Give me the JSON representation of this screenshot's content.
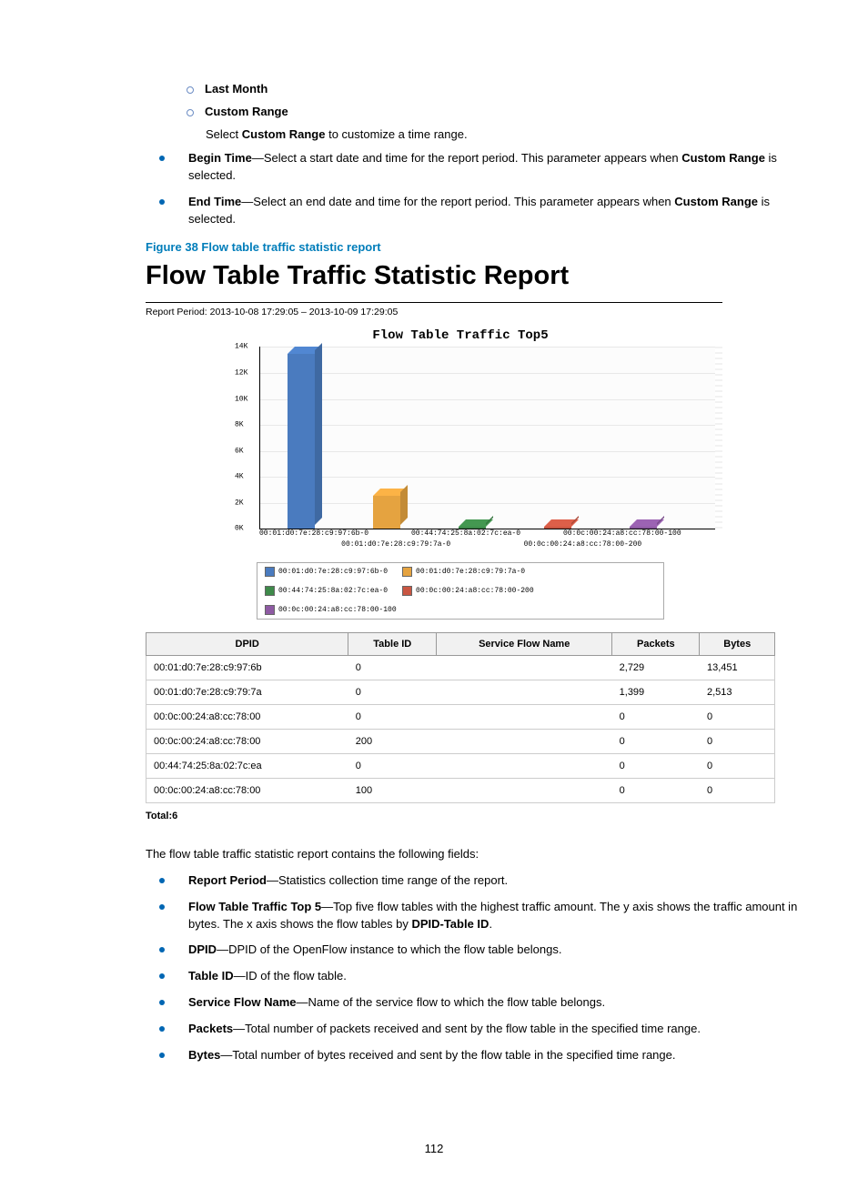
{
  "sub_items": [
    {
      "label": "Last Month"
    },
    {
      "label": "Custom Range"
    }
  ],
  "select_hint": {
    "pre": "Select ",
    "bold": "Custom Range",
    "post": " to customize a time range."
  },
  "upper_bullets": [
    {
      "bold": "Begin Time",
      "tail": "—Select a start date and time for the report period. This parameter appears when ",
      "bold2": "Custom Range",
      "tail2": " is selected."
    },
    {
      "bold": "End Time",
      "tail": "—Select an end date and time for the report period. This parameter appears when ",
      "bold2": "Custom Range",
      "tail2": " is selected."
    }
  ],
  "figure_caption": "Figure 38 Flow table traffic statistic report",
  "report_title": "Flow Table Traffic Statistic Report",
  "report_period": "Report Period: 2013-10-08 17:29:05  –  2013-10-09 17:29:05",
  "chart_data": {
    "type": "bar",
    "title": "Flow Table Traffic Top5",
    "y_ticks": [
      "0K",
      "2K",
      "4K",
      "6K",
      "8K",
      "10K",
      "12K",
      "14K"
    ],
    "ylim": [
      0,
      14000
    ],
    "x_top": [
      "00:01:d0:7e:28:c9:97:6b-0",
      "00:44:74:25:8a:02:7c:ea-0",
      "00:0c:00:24:a8:cc:78:00-100"
    ],
    "x_bot": [
      "00:01:d0:7e:28:c9:79:7a-0",
      "00:0c:00:24:a8:cc:78:00-200"
    ],
    "series": [
      {
        "name": "00:01:d0:7e:28:c9:97:6b-0",
        "value": 13451,
        "color": "#4a7bbf"
      },
      {
        "name": "00:01:d0:7e:28:c9:79:7a-0",
        "value": 2513,
        "color": "#e5a340"
      },
      {
        "name": "00:44:74:25:8a:02:7c:ea-0",
        "value": 120,
        "color": "#3e8a4a"
      },
      {
        "name": "00:0c:00:24:a8:cc:78:00-200",
        "value": 90,
        "color": "#c95642"
      },
      {
        "name": "00:0c:00:24:a8:cc:78:00-100",
        "value": 70,
        "color": "#8e5aa3"
      }
    ]
  },
  "table": {
    "headers": [
      "DPID",
      "Table ID",
      "Service Flow Name",
      "Packets",
      "Bytes"
    ],
    "col_align": [
      "left",
      "left",
      "left",
      "left",
      "left"
    ],
    "rows": [
      [
        "00:01:d0:7e:28:c9:97:6b",
        "0",
        "",
        "2,729",
        "13,451"
      ],
      [
        "00:01:d0:7e:28:c9:79:7a",
        "0",
        "",
        "1,399",
        "2,513"
      ],
      [
        "00:0c:00:24:a8:cc:78:00",
        "0",
        "",
        "0",
        "0"
      ],
      [
        "00:0c:00:24:a8:cc:78:00",
        "200",
        "",
        "0",
        "0"
      ],
      [
        "00:44:74:25:8a:02:7c:ea",
        "0",
        "",
        "0",
        "0"
      ],
      [
        "00:0c:00:24:a8:cc:78:00",
        "100",
        "",
        "0",
        "0"
      ]
    ]
  },
  "total_text": "Total:6",
  "fields_intro": "The flow table traffic statistic report contains the following fields:",
  "lower_bullets": [
    {
      "bold": "Report Period",
      "tail": "—Statistics collection time range of the report."
    },
    {
      "bold": "Flow Table Traffic Top 5",
      "tail": "—Top five flow tables with the highest traffic amount. The y axis shows the traffic amount in bytes. The x axis shows the flow tables by ",
      "bold2": "DPID-Table ID",
      "tail2": "."
    },
    {
      "bold": "DPID",
      "tail": "—DPID of the OpenFlow instance to which the flow table belongs."
    },
    {
      "bold": "Table ID",
      "tail": "—ID of the flow table."
    },
    {
      "bold": "Service Flow Name",
      "tail": "—Name of the service flow to which the flow table belongs."
    },
    {
      "bold": "Packets",
      "tail": "—Total number of packets received and sent by the flow table in the specified time range."
    },
    {
      "bold": "Bytes",
      "tail": "—Total number of bytes received and sent by the flow table in the specified time range."
    }
  ],
  "page_number": "112"
}
